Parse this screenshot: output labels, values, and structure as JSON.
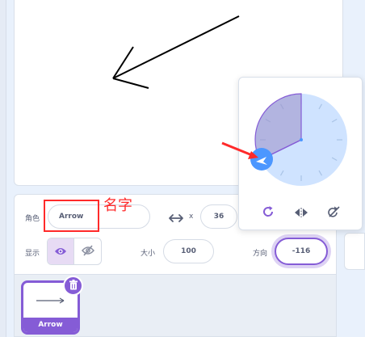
{
  "stage": {
    "sprite_name": "Arrow"
  },
  "sprite_info": {
    "sprite_label": "角色",
    "sprite_name_value": "Arrow",
    "x_label": "x",
    "x_value": "36",
    "show_label": "显示",
    "size_label": "大小",
    "size_value": "100",
    "direction_label": "方向",
    "direction_value": "-116"
  },
  "annotation": {
    "text": "名字"
  },
  "sprite_list": {
    "items": [
      {
        "name": "Arrow",
        "selected": true
      }
    ]
  },
  "direction_popover": {
    "direction": -116,
    "modes": [
      "all-around-rotation",
      "left-right",
      "dont-rotate"
    ],
    "active_mode": "all-around-rotation"
  },
  "colors": {
    "accent": "#855cd6",
    "dial": "#cfe3ff",
    "dial_knob": "#4c97ff",
    "annotation": "#ff2a2a"
  }
}
